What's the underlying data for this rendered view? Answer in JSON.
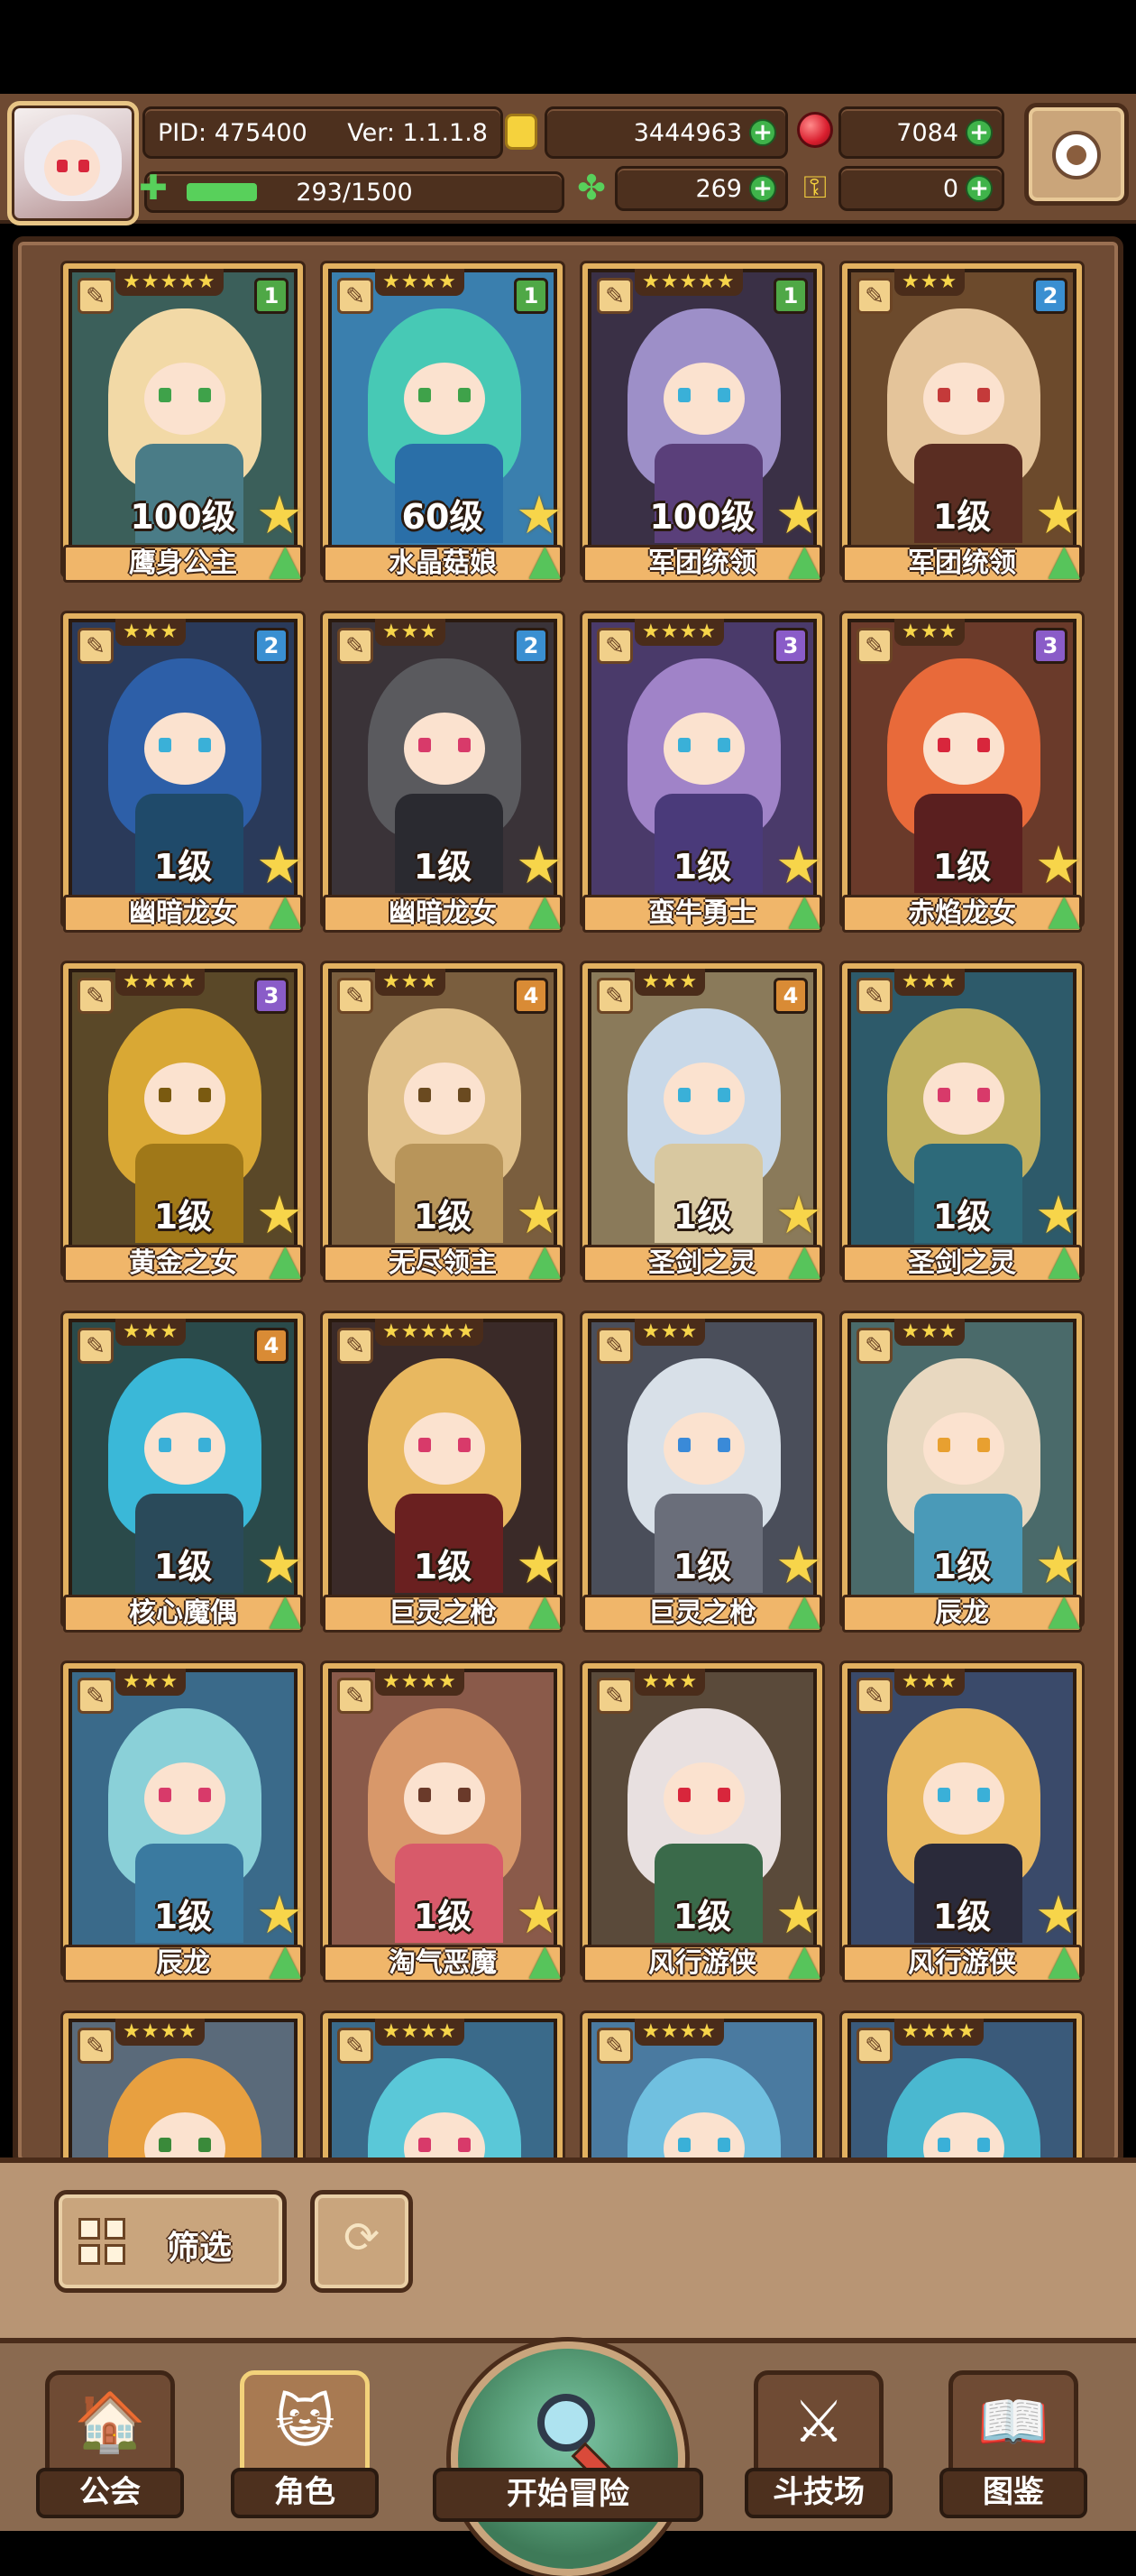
{
  "header": {
    "pid": "PID: 475400",
    "version": "Ver: 1.1.1.8",
    "gold": "3444963",
    "gems": "7084",
    "stamina": "293/1500",
    "stamina_fraction": 0.195,
    "clover": "269",
    "keys": "0",
    "icons": {
      "avatar": "player-avatar",
      "gold": "gold-coin-icon",
      "gem": "red-gem-icon",
      "stamina": "stamina-icon",
      "clover": "clover-icon",
      "key": "key-icon",
      "plus": "plus-icon",
      "settings": "gear-icon"
    }
  },
  "cards": [
    {
      "stars": "★★★★★",
      "tier": "1",
      "level": "100级",
      "name": "鹰身公主",
      "hair": "#f2d9a6",
      "body": "#4a7c87",
      "eye": "#3fa24a",
      "bg": "#3b5f5a"
    },
    {
      "stars": "★★★★",
      "tier": "1",
      "level": "60级",
      "name": "水晶菇娘",
      "hair": "#47c9b5",
      "body": "#2a6fa8",
      "eye": "#3fa24a",
      "bg": "#3a7fae"
    },
    {
      "stars": "★★★★★",
      "tier": "1",
      "level": "100级",
      "name": "军团统领",
      "hair": "#9d8fc8",
      "body": "#5a3f7a",
      "eye": "#3ab0d8",
      "bg": "#3a3046"
    },
    {
      "stars": "★★★",
      "tier": "2",
      "level": "1级",
      "name": "军团统领",
      "hair": "#e4c49a",
      "body": "#5a2d22",
      "eye": "#c43a3a",
      "bg": "#6c4a2c"
    },
    {
      "stars": "★★★",
      "tier": "2",
      "level": "1级",
      "name": "幽暗龙女",
      "hair": "#2d5fa8",
      "body": "#1f4a6a",
      "eye": "#3ab0d8",
      "bg": "#2a3a5a"
    },
    {
      "stars": "★★★",
      "tier": "2",
      "level": "1级",
      "name": "幽暗龙女",
      "hair": "#5a5a5e",
      "body": "#2a2a30",
      "eye": "#d83a6a",
      "bg": "#3a3338"
    },
    {
      "stars": "★★★★",
      "tier": "3",
      "level": "1级",
      "name": "蛮牛勇士",
      "hair": "#a083c8",
      "body": "#4a3a7a",
      "eye": "#3ab0d8",
      "bg": "#4a3a6a"
    },
    {
      "stars": "★★★",
      "tier": "3",
      "level": "1级",
      "name": "赤焰龙女",
      "hair": "#e86a3a",
      "body": "#5a1f1f",
      "eye": "#d8263c",
      "bg": "#6a3a2a"
    },
    {
      "stars": "★★★★",
      "tier": "3",
      "level": "1级",
      "name": "黄金之女",
      "hair": "#d9a834",
      "body": "#a07818",
      "eye": "#7a5a10",
      "bg": "#5a4828"
    },
    {
      "stars": "★★★",
      "tier": "4",
      "level": "1级",
      "name": "无尽领主",
      "hair": "#e0c089",
      "body": "#b8955a",
      "eye": "#6a4a20",
      "bg": "#7a5e3e"
    },
    {
      "stars": "★★★",
      "tier": "4",
      "level": "1级",
      "name": "圣剑之灵",
      "hair": "#c8d8e8",
      "body": "#d8c8a0",
      "eye": "#3ab0d8",
      "bg": "#8a7a5a"
    },
    {
      "stars": "★★★",
      "tier": "",
      "level": "1级",
      "name": "圣剑之灵",
      "hair": "#c0b060",
      "body": "#2d6a7a",
      "eye": "#d83a6a",
      "bg": "#2d5a6a"
    },
    {
      "stars": "★★★",
      "tier": "4",
      "level": "1级",
      "name": "核心魔偶",
      "hair": "#3ab8d8",
      "body": "#2a4a5a",
      "eye": "#3ab0d8",
      "bg": "#2a4a4a"
    },
    {
      "stars": "★★★★★",
      "tier": "",
      "level": "1级",
      "name": "巨灵之枪",
      "hair": "#e8b860",
      "body": "#6a2020",
      "eye": "#d83a6a",
      "bg": "#3a2a28"
    },
    {
      "stars": "★★★",
      "tier": "",
      "level": "1级",
      "name": "巨灵之枪",
      "hair": "#d8e0e8",
      "body": "#6a6e7a",
      "eye": "#3a8ad8",
      "bg": "#4a4e5a"
    },
    {
      "stars": "★★★",
      "tier": "",
      "level": "1级",
      "name": "辰龙",
      "hair": "#e8d8c0",
      "body": "#4a9ab8",
      "eye": "#e8a030",
      "bg": "#4a6a6a"
    },
    {
      "stars": "★★★",
      "tier": "",
      "level": "1级",
      "name": "辰龙",
      "hair": "#8ad0d8",
      "body": "#3a7aa0",
      "eye": "#d83a6a",
      "bg": "#3a6a8a"
    },
    {
      "stars": "★★★★",
      "tier": "",
      "level": "1级",
      "name": "淘气恶魔",
      "hair": "#d8986a",
      "body": "#d85a6a",
      "eye": "#6a3a2a",
      "bg": "#8a5a4a"
    },
    {
      "stars": "★★★",
      "tier": "",
      "level": "1级",
      "name": "风行游侠",
      "hair": "#e8e0e0",
      "body": "#3a6a4a",
      "eye": "#d8263c",
      "bg": "#5a4a3a"
    },
    {
      "stars": "★★★",
      "tier": "",
      "level": "1级",
      "name": "风行游侠",
      "hair": "#e8b860",
      "body": "#2a2a3a",
      "eye": "#3ab0d8",
      "bg": "#3a4a6a"
    },
    {
      "stars": "★★★★",
      "tier": "",
      "level": "",
      "name": "",
      "hair": "#e8a040",
      "body": "#c86a3a",
      "eye": "#3a8a3a",
      "bg": "#5a6a7a"
    },
    {
      "stars": "★★★★",
      "tier": "",
      "level": "",
      "name": "",
      "hair": "#5ac8d8",
      "body": "#4a8aa8",
      "eye": "#d83a6a",
      "bg": "#3a6a8a"
    },
    {
      "stars": "★★★★",
      "tier": "",
      "level": "",
      "name": "",
      "hair": "#70c0e0",
      "body": "#3a7aa0",
      "eye": "#3ab0d8",
      "bg": "#4a7aa0"
    },
    {
      "stars": "★★★★",
      "tier": "",
      "level": "",
      "name": "",
      "hair": "#4ab8d0",
      "body": "#2a6a8a",
      "eye": "#3ab0d8",
      "bg": "#3a5a7a"
    }
  ],
  "controls": {
    "filter_label": "筛选",
    "filter_icon": "grid-icon",
    "reset_icon": "refresh-icon"
  },
  "nav": {
    "guild": "公会",
    "character": "角色",
    "adventure": "开始冒险",
    "arena": "斗技场",
    "codex": "图鉴"
  }
}
